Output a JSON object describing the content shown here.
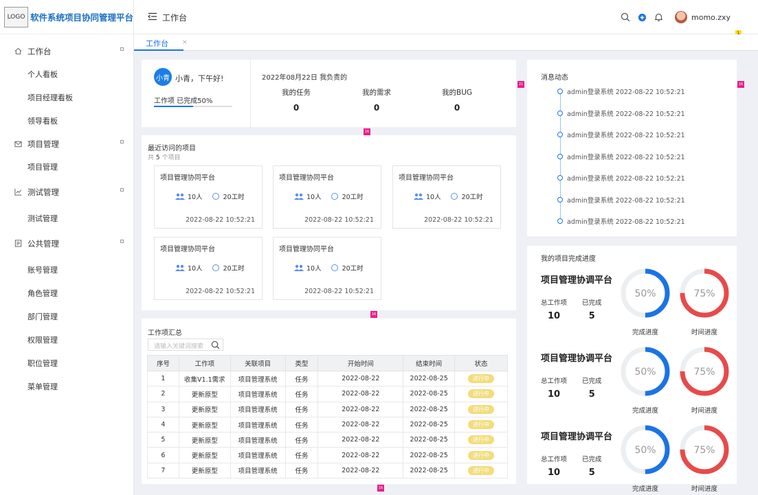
{
  "app": {
    "logo": "LOGO",
    "title": "软件系统项目协同管理平台"
  },
  "header": {
    "title": "工作台",
    "username": "momo.zxy",
    "notif_count": "1"
  },
  "sidebar": {
    "groups": [
      {
        "label": "工作台",
        "icon": "home-icon",
        "items": [
          "个人看板",
          "项目经理看板",
          "领导看板"
        ]
      },
      {
        "label": "项目管理",
        "icon": "mail-icon",
        "items": [
          "项目管理"
        ]
      },
      {
        "label": "测试管理",
        "icon": "chart-icon",
        "items": [
          "测试管理"
        ]
      },
      {
        "label": "公共管理",
        "icon": "doc-icon",
        "items": [
          "账号管理",
          "角色管理",
          "部门管理",
          "权限管理",
          "职位管理",
          "菜单管理"
        ]
      }
    ]
  },
  "tabs": [
    {
      "label": "工作台",
      "close": "×"
    }
  ],
  "greeting": {
    "avatar_text": "小青",
    "text": "小青，下午好!",
    "progress_label": "工作项 已完成50%",
    "progress": 0.5,
    "date_title": "2022年08月22日 我负责的",
    "stats": [
      {
        "label": "我的任务",
        "value": "0"
      },
      {
        "label": "我的需求",
        "value": "0"
      },
      {
        "label": "我的BUG",
        "value": "0"
      }
    ]
  },
  "badges": {
    "b21": "21",
    "b16a": "16",
    "b16b": "16",
    "b16c": "16",
    "b16d": "16"
  },
  "recent": {
    "title": "最近访问的项目",
    "count_prefix": "共",
    "count": "5",
    "count_suffix": "个项目",
    "projects": [
      {
        "name": "项目管理协同平台",
        "people": "10人",
        "hours": "20工时",
        "date": "2022-08-22 10:52:21"
      },
      {
        "name": "项目管理协同平台",
        "people": "10人",
        "hours": "20工时",
        "date": "2022-08-22 10:52:21"
      },
      {
        "name": "项目管理协同平台",
        "people": "10人",
        "hours": "20工时",
        "date": "2022-08-22 10:52:21"
      },
      {
        "name": "项目管理协同平台",
        "people": "10人",
        "hours": "20工时",
        "date": "2022-08-22 10:52:21"
      },
      {
        "name": "项目管理协同平台",
        "people": "10人",
        "hours": "20工时",
        "date": "2022-08-22 10:52:21"
      }
    ]
  },
  "workitems": {
    "title": "工作项汇总",
    "search_placeholder": "请输入关键词搜索",
    "columns": [
      "序号",
      "工作项",
      "关联项目",
      "类型",
      "开始时间",
      "结束时间",
      "状态"
    ],
    "rows": [
      [
        "1",
        "收集V1.1需求",
        "项目管理系统",
        "任务",
        "2022-08-22",
        "2022-08-25",
        "进行中"
      ],
      [
        "2",
        "更新原型",
        "项目管理系统",
        "任务",
        "2022-08-22",
        "2022-08-25",
        "进行中"
      ],
      [
        "3",
        "更新原型",
        "项目管理系统",
        "任务",
        "2022-08-22",
        "2022-08-25",
        "进行中"
      ],
      [
        "4",
        "更新原型",
        "项目管理系统",
        "任务",
        "2022-08-22",
        "2022-08-25",
        "进行中"
      ],
      [
        "5",
        "更新原型",
        "项目管理系统",
        "任务",
        "2022-08-22",
        "2022-08-25",
        "进行中"
      ],
      [
        "6",
        "更新原型",
        "项目管理系统",
        "任务",
        "2022-08-22",
        "2022-08-25",
        "进行中"
      ],
      [
        "7",
        "更新原型",
        "项目管理系统",
        "任务",
        "2022-08-22",
        "2022-08-25",
        "进行中"
      ]
    ]
  },
  "messages": {
    "title": "消息动态",
    "items": [
      "admin登录系统 2022-08-22 10:52:21",
      "admin登录系统 2022-08-22 10:52:21",
      "admin登录系统 2022-08-22 10:52:21",
      "admin登录系统 2022-08-22 10:52:21",
      "admin登录系统 2022-08-22 10:52:21",
      "admin登录系统 2022-08-22 10:52:21",
      "admin登录系统 2022-08-22 10:52:21"
    ]
  },
  "progress": {
    "title": "我的项目完成进度",
    "projects": [
      {
        "name": "项目管理协调平台",
        "total_label": "总工作项",
        "total": "10",
        "done_label": "已完成",
        "done": "5",
        "complete_pct": 50,
        "complete_text": "50%",
        "complete_label": "完成进度",
        "time_pct": 75,
        "time_text": "75%",
        "time_label": "时间进度"
      },
      {
        "name": "项目管理协调平台",
        "total_label": "总工作项",
        "total": "10",
        "done_label": "已完成",
        "done": "5",
        "complete_pct": 50,
        "complete_text": "50%",
        "complete_label": "完成进度",
        "time_pct": 75,
        "time_text": "75%",
        "time_label": "时间进度"
      },
      {
        "name": "项目管理协调平台",
        "total_label": "总工作项",
        "total": "10",
        "done_label": "已完成",
        "done": "5",
        "complete_pct": 50,
        "complete_text": "50%",
        "complete_label": "完成进度",
        "time_pct": 75,
        "time_text": "75%",
        "time_label": "时间进度"
      }
    ]
  },
  "colors": {
    "primary": "#1a73e8",
    "time": "#e84a4a",
    "track": "#eceff1",
    "pill": "#f3dc7c",
    "badge": "#e91e8c"
  }
}
